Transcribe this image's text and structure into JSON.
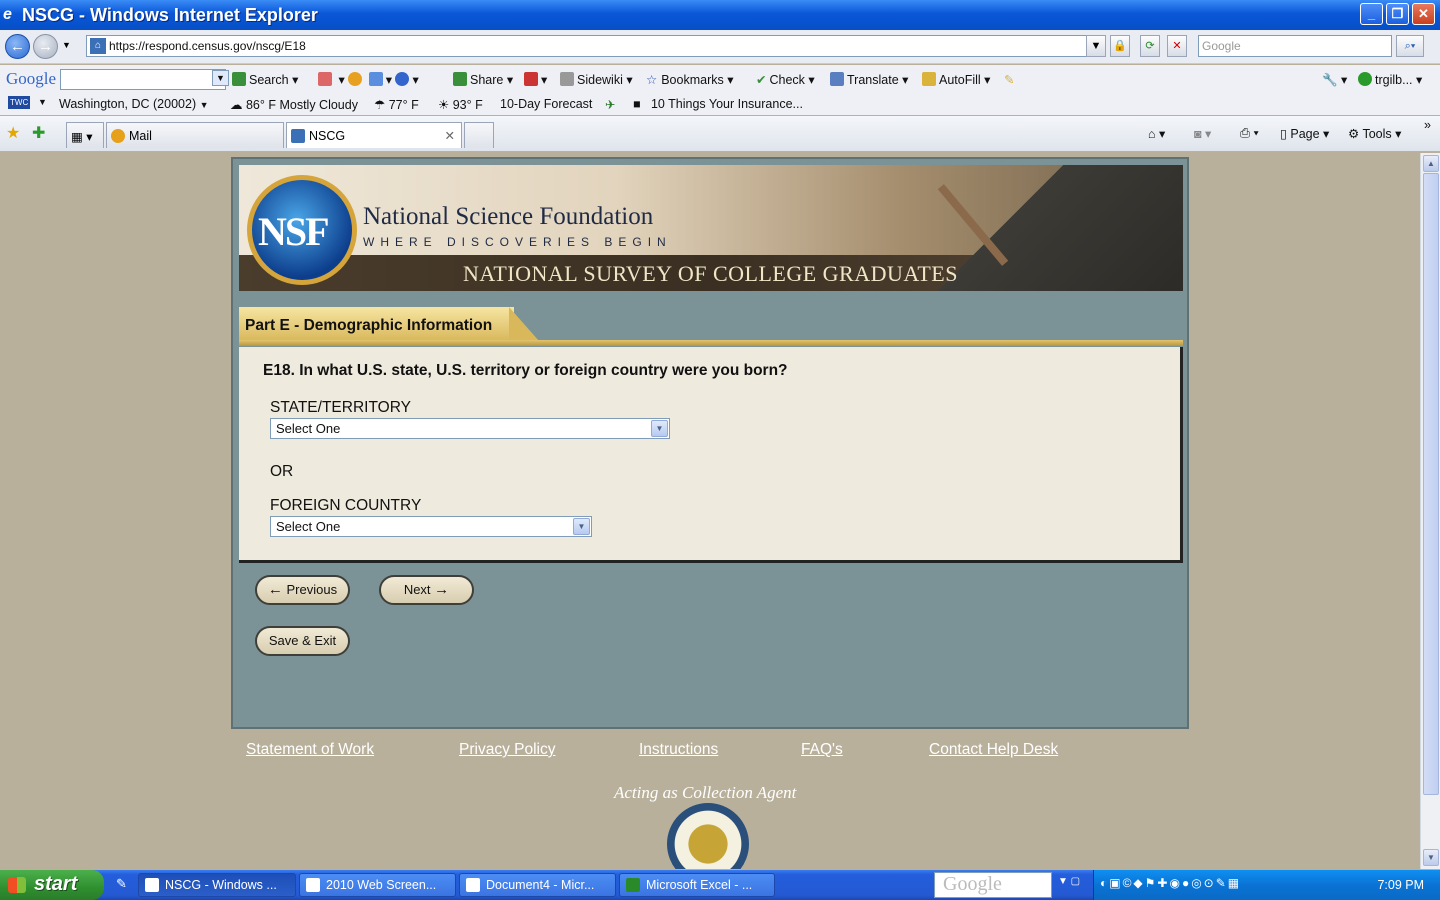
{
  "window": {
    "title": "NSCG - Windows Internet Explorer"
  },
  "address": {
    "url": "https://respond.census.gov/nscg/E18",
    "search_placeholder": "Google"
  },
  "google_toolbar": {
    "logo": "Google",
    "items": [
      "Search",
      "Share",
      "Sidewiki",
      "Bookmarks",
      "Check",
      "Translate",
      "AutoFill",
      "trgilb..."
    ]
  },
  "weather_toolbar": {
    "badge": "TWC",
    "location": "Washington, DC (20002)",
    "current": "86° F Mostly Cloudy",
    "temp1": "77° F",
    "temp2": "93° F",
    "forecast": "10-Day Forecast",
    "video": "10 Things Your Insurance..."
  },
  "tabs": [
    {
      "label": "Mail"
    },
    {
      "label": "NSCG"
    }
  ],
  "commands": {
    "page": "Page",
    "tools": "Tools"
  },
  "banner": {
    "org": "National Science Foundation",
    "tagline": "WHERE DISCOVERIES BEGIN",
    "survey": "NATIONAL SURVEY OF COLLEGE GRADUATES",
    "seal_letters": "NSF"
  },
  "section": {
    "title": "Part E - Demographic Information"
  },
  "question": {
    "text": "E18. In what U.S. state, U.S. territory or foreign country were you born?",
    "state_label": "STATE/TERRITORY",
    "state_value": "Select One",
    "or_text": "OR",
    "country_label": "FOREIGN COUNTRY",
    "country_value": "Select One"
  },
  "buttons": {
    "previous": "Previous",
    "next": "Next",
    "save_exit": "Save & Exit"
  },
  "footer": {
    "links": [
      "Statement of Work",
      "Privacy Policy",
      "Instructions",
      "FAQ's",
      "Contact Help Desk"
    ],
    "agent": "Acting as Collection Agent"
  },
  "taskbar": {
    "start": "start",
    "tasks": [
      "NSCG - Windows ...",
      "2010 Web Screen...",
      "Document4 - Micr...",
      "Microsoft Excel - ..."
    ],
    "search_logo": "Google",
    "clock": "7:09 PM"
  }
}
